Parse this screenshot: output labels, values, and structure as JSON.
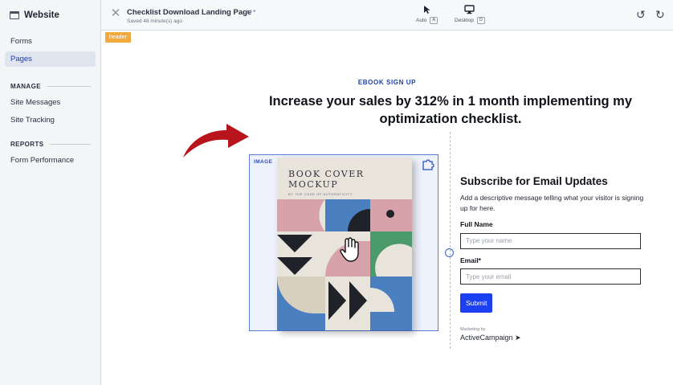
{
  "sidebar": {
    "title": "Website",
    "nav": [
      {
        "label": "Forms",
        "active": false
      },
      {
        "label": "Pages",
        "active": true
      }
    ],
    "sections": [
      {
        "label": "MANAGE",
        "items": [
          "Site Messages",
          "Site Tracking"
        ]
      },
      {
        "label": "REPORTS",
        "items": [
          "Form Performance"
        ]
      }
    ]
  },
  "topbar": {
    "page_title": "Checklist Download Landing Page",
    "more": "•••",
    "saved": "Saved 48 minute(s) ago",
    "views": [
      {
        "label": "Auto",
        "key": "A",
        "icon": "cursor-icon"
      },
      {
        "label": "Desktop",
        "key": "D",
        "icon": "monitor-icon"
      }
    ],
    "undo_icon": "↺",
    "redo_icon": "↻"
  },
  "canvas": {
    "section_tag": "header",
    "eyebrow": "EBOOK SIGN UP",
    "headline": "Increase your sales by 312% in 1 month implementing my optimization checklist.",
    "image_label": "IMAGE",
    "book_title": "BOOK COVER MOCKUP",
    "book_subtitle": "BY THE CODE OF AUTHENTICITY"
  },
  "form": {
    "title": "Subscribe for Email Updates",
    "description": "Add a descriptive message telling what your visitor is signing up for here.",
    "fields": [
      {
        "label": "Full Name",
        "placeholder": "Type your name"
      },
      {
        "label": "Email*",
        "placeholder": "Type your email"
      }
    ],
    "submit": "Submit",
    "marketing_by": "Marketing by",
    "brand": "ActiveCampaign ➤"
  },
  "colors": {
    "accent": "#1c3ff0",
    "section_tag": "#f2a93b",
    "selection": "#5b7ad6",
    "arrow": "#b8141b"
  }
}
